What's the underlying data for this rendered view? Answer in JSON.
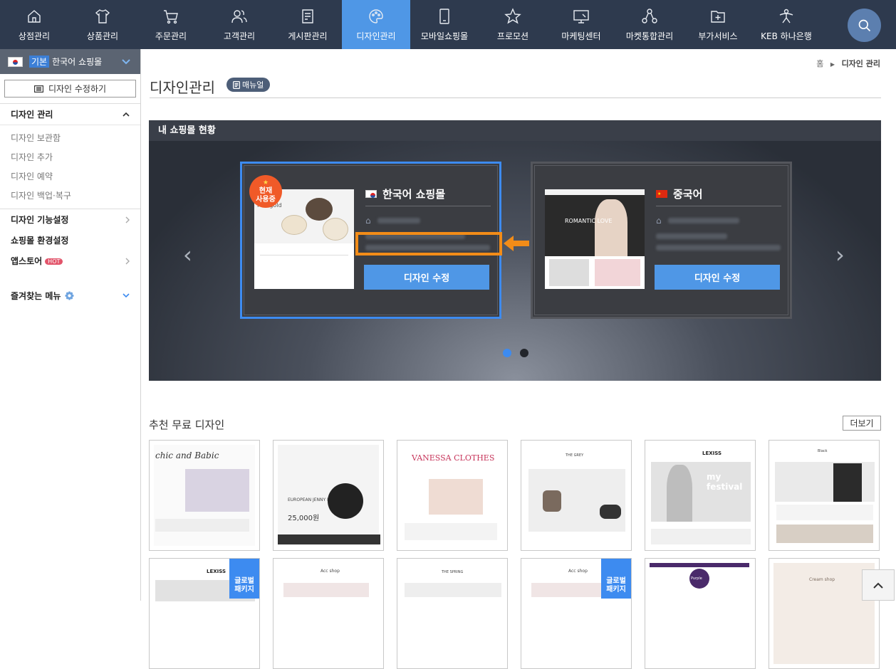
{
  "nav": {
    "items": [
      {
        "label": "상점관리",
        "icon": "store-icon"
      },
      {
        "label": "상품관리",
        "icon": "shirt-icon"
      },
      {
        "label": "주문관리",
        "icon": "cart-icon"
      },
      {
        "label": "고객관리",
        "icon": "users-icon"
      },
      {
        "label": "게시판관리",
        "icon": "board-icon"
      },
      {
        "label": "디자인관리",
        "icon": "palette-icon"
      },
      {
        "label": "모바일쇼핑몰",
        "icon": "mobile-icon"
      },
      {
        "label": "프로모션",
        "icon": "star-icon"
      },
      {
        "label": "마케팅센터",
        "icon": "monitor-icon"
      },
      {
        "label": "마켓통합관리",
        "icon": "network-icon"
      },
      {
        "label": "부가서비스",
        "icon": "folder-plus-icon"
      },
      {
        "label": "KEB 하나은행",
        "icon": "bank-icon"
      }
    ],
    "active_index": 5
  },
  "sidebar": {
    "mall_tag": "기본",
    "mall_name": "한국어 쇼핑몰",
    "edit_button": "디자인 수정하기",
    "section_title": "디자인 관리",
    "sub_items": [
      "디자인 보관함",
      "디자인 추가",
      "디자인 예약",
      "디자인 백업·복구"
    ],
    "menus": [
      "디자인 기능설정",
      "쇼핑몰 환경설정",
      "앱스토어"
    ],
    "hot_badge": "HOT",
    "favorites": "즐겨찾는 메뉴"
  },
  "breadcrumb": {
    "home": "홈",
    "current": "디자인 관리"
  },
  "page": {
    "title": "디자인관리",
    "manual_button": "매뉴얼"
  },
  "status_panel": {
    "title": "내 쇼핑몰 현황",
    "cards": [
      {
        "name": "한국어 쇼핑몰",
        "button": "디자인 수정",
        "badge_line1": "현재",
        "badge_line2": "사용중",
        "thumb_text": "Marigold"
      },
      {
        "name": "중국어",
        "button": "디자인 수정",
        "thumb_text": "ROMANTIC LOVE"
      }
    ],
    "prev_arrow": "‹",
    "next_arrow": "›"
  },
  "recommended": {
    "title": "추천 무료 디자인",
    "more_button": "더보기",
    "thumbs_row1": [
      "chic and Babic",
      "EUROPEAN JENNY LUXE CHAIR",
      "VANESSA CLOTHES",
      "THE GREY",
      "LEXISS",
      "Black"
    ],
    "thumbs_row2": [
      "LEXISS",
      "Acc shop",
      "THE SPRING",
      "Acc shop",
      "Purple",
      "Cream shop"
    ],
    "global_badge_line1": "글로벌",
    "global_badge_line2": "패키지",
    "price_text": "25,000원",
    "festival_text": "my festival"
  },
  "colors": {
    "nav_bg": "#2e3a4e",
    "active": "#4f97e6",
    "highlight": "#f28c18",
    "badge": "#f05a28"
  }
}
